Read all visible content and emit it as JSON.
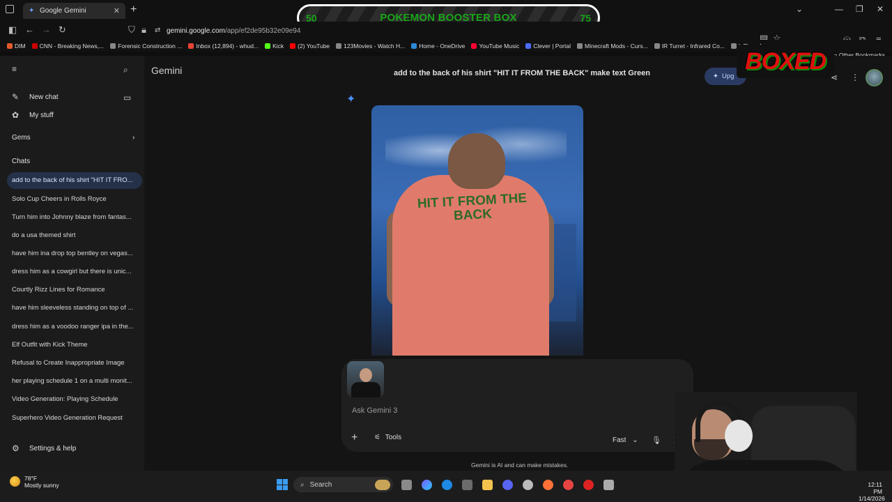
{
  "browser": {
    "tab_title": "Google Gemini",
    "url_host": "gemini.google.com",
    "url_path": "/app/ef2de95b32e09e94",
    "bookmarks": [
      {
        "label": "DIM",
        "color": "#e05a2a"
      },
      {
        "label": "CNN - Breaking News,...",
        "color": "#cc0000"
      },
      {
        "label": "Forensic Construction ...",
        "color": "#888888"
      },
      {
        "label": "Inbox (12,894) - whud...",
        "color": "#ea4335"
      },
      {
        "label": "Kick",
        "color": "#53fc18"
      },
      {
        "label": "(2) YouTube",
        "color": "#ff0000"
      },
      {
        "label": "123Movies - Watch H...",
        "color": "#888888"
      },
      {
        "label": "Home - OneDrive",
        "color": "#2b88d8"
      },
      {
        "label": "YouTube Music",
        "color": "#ff0033"
      },
      {
        "label": "Clever | Portal",
        "color": "#4a6cf7"
      },
      {
        "label": "Minecraft Mods - Curs...",
        "color": "#888888"
      },
      {
        "label": "IR Turret - Infrared Co...",
        "color": "#888888"
      },
      {
        "label": "IsThereAn",
        "color": "#888888"
      }
    ],
    "other_bookmarks": "Other Bookmarks"
  },
  "overlay": {
    "left_number": "50",
    "title": "POKEMON BOOSTER BOX",
    "right_number": "75"
  },
  "stream_logo": "BOXED",
  "sidebar": {
    "new_chat": "New chat",
    "my_stuff": "My stuff",
    "gems": "Gems",
    "chats_heading": "Chats",
    "chats": [
      "add to the back of his shirt \"HIT IT FRO...",
      "Solo Cup Cheers in Rolls Royce",
      "Turn him into Johnny blaze from fantas...",
      "do a usa themed shirt",
      "have him ina drop top bentley on vegas...",
      "dress him as a cowgirl but there is unic...",
      "Courtly Rizz Lines for Romance",
      "have him sleeveless standing on top of ...",
      "dress him as a voodoo ranger ipa in the...",
      "Elf Outfit with Kick Theme",
      "Refusal to Create Inappropriate Image",
      "her playing schedule 1 on a multi monit...",
      "Video Generation: Playing Schedule",
      "Superhero Video Generation Request"
    ],
    "settings": "Settings & help"
  },
  "main": {
    "brand": "Gemini",
    "prompt_title": "add to the back of his shirt \"HIT IT FROM THE BACK\" make text Green",
    "upgrade_label": "Upg",
    "image_shirt_text": "HIT IT FROM THE BACK",
    "composer_placeholder": "Ask Gemini 3",
    "tools_label": "Tools",
    "mode_label": "Fast",
    "disclaimer": "Gemini is AI and can make mistakes."
  },
  "taskbar": {
    "weather_temp": "78°F",
    "weather_desc": "Mostly sunny",
    "search_label": "Search",
    "time": "12:11 PM",
    "date": "1/14/2026"
  },
  "colors": {
    "accent": "#4d8df5",
    "overlay_text": "#1aa51a",
    "shirt_text": "#2f6a2a"
  }
}
